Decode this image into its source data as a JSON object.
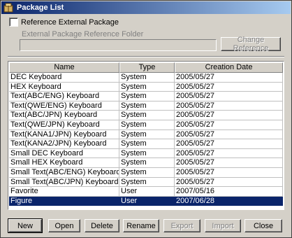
{
  "window": {
    "title": "Package List"
  },
  "external": {
    "checkbox_label": "Reference External Package",
    "checked": false,
    "folder_label": "External Package Reference Folder",
    "folder_value": "",
    "change_button": "Change Reference"
  },
  "table": {
    "columns": [
      "Name",
      "Type",
      "Creation Date"
    ],
    "rows": [
      [
        "DEC Keyboard",
        "System",
        "2005/05/27"
      ],
      [
        "HEX Keyboard",
        "System",
        "2005/05/27"
      ],
      [
        "Text(ABC/ENG) Keyboard",
        "System",
        "2005/05/27"
      ],
      [
        "Text(QWE/ENG) Keyboard",
        "System",
        "2005/05/27"
      ],
      [
        "Text(ABC/JPN) Keyboard",
        "System",
        "2005/05/27"
      ],
      [
        "Text(QWE/JPN) Keyboard",
        "System",
        "2005/05/27"
      ],
      [
        "Text(KANA1/JPN) Keyboard",
        "System",
        "2005/05/27"
      ],
      [
        "Text(KANA2/JPN) Keyboard",
        "System",
        "2005/05/27"
      ],
      [
        "Small DEC Keyboard",
        "System",
        "2005/05/27"
      ],
      [
        "Small HEX Keyboard",
        "System",
        "2005/05/27"
      ],
      [
        "Small Text(ABC/ENG) Keyboard",
        "System",
        "2005/05/27"
      ],
      [
        "Small Text(ABC/JPN) Keyboard",
        "System",
        "2005/05/27"
      ],
      [
        "Favorite",
        "User",
        "2007/05/16"
      ],
      [
        "Figure",
        "User",
        "2007/06/28"
      ]
    ],
    "selected_row": 13
  },
  "buttons": {
    "new": "New",
    "open": "Open",
    "delete": "Delete",
    "rename": "Rename",
    "export": "Export",
    "import": "Import",
    "close": "Close"
  }
}
